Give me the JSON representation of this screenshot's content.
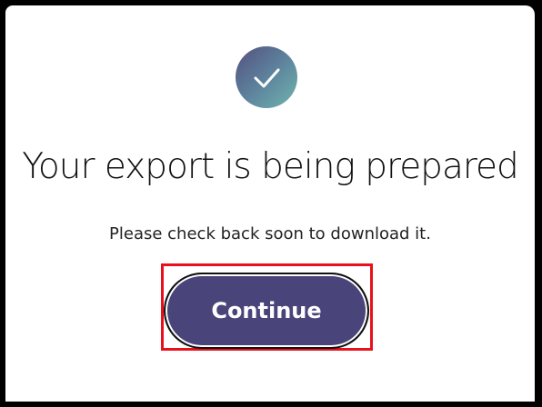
{
  "dialog": {
    "title": "Your export is being prepared",
    "message": "Please check back soon to download it.",
    "continue_label": "Continue",
    "icon": "checkmark-icon"
  },
  "colors": {
    "button_background": "#49457a",
    "highlight_border": "#e8101a",
    "icon_gradient_start": "#55507e",
    "icon_gradient_end": "#6fb5b0"
  }
}
